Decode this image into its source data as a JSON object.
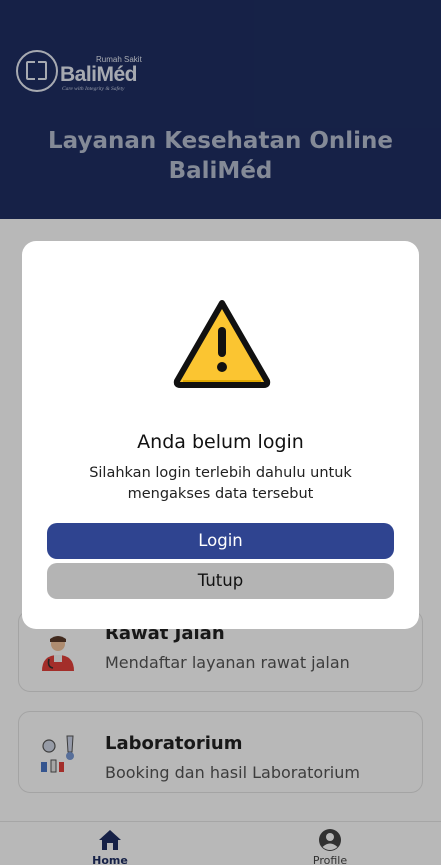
{
  "header": {
    "logo": {
      "small": "Rumah Sakit",
      "name": "BaliMéd",
      "tagline": "Care with Integrity & Safety"
    },
    "title": "Layanan Kesehatan Online BaliMéd"
  },
  "cards": [
    {
      "title": "Rawat Jalan",
      "desc": "Mendaftar layanan rawat jalan",
      "icon": "doctor-icon"
    },
    {
      "title": "Laboratorium",
      "desc": "Booking dan hasil Laboratorium",
      "icon": "lab-icon"
    }
  ],
  "bottom_nav": {
    "items": [
      {
        "label": "Home",
        "icon": "home-icon",
        "active": true
      },
      {
        "label": "Profile",
        "icon": "profile-icon",
        "active": false
      }
    ],
    "active_color": "#1f2f63",
    "inactive_color": "#444444"
  },
  "modal": {
    "icon": "warning-icon",
    "title": "Anda belum login",
    "message": "Silahkan login terlebih dahulu untuk mengakses data tersebut",
    "login_label": "Login",
    "close_label": "Tutup"
  },
  "colors": {
    "brand": "#1f2f63",
    "primary_button": "#2f4490",
    "secondary_button": "#b4b4b4",
    "warning": "#fbc531"
  }
}
